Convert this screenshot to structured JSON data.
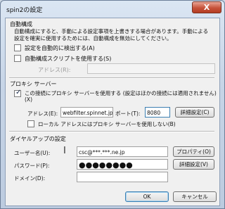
{
  "window": {
    "title": "spin2の設定",
    "close_glyph": "X"
  },
  "auto_config": {
    "heading": "自動構成",
    "note_line1": "自動構成にすると、手動による設定事項を上書きする場合があります。手動による",
    "note_line2": "設定を確実に使用するためには、自動構成を無効にしてください。",
    "auto_detect_label": "設定を自動的に検出する(A)",
    "auto_detect_checked": false,
    "use_script_label": "自動構成スクリプトを使用する(S)",
    "use_script_checked": false,
    "address_label": "アドレス(R):",
    "address_value": ""
  },
  "proxy": {
    "heading": "プロキシ サーバー",
    "use_proxy_label_line1": "この接続にプロキシ サーバーを使用する (設定はほかの接続には適用されません)",
    "use_proxy_label_line2": "(X)",
    "use_proxy_checked": true,
    "address_label": "アドレス(E):",
    "address_value": "webfilter.spinnet.jp",
    "port_label": "ポート(T):",
    "port_value": "8080",
    "advanced_label": "詳細設定(C)",
    "bypass_local_label": "ローカル アドレスにはプロキシ サーバーを使用しない(B)",
    "bypass_local_checked": false
  },
  "dialup": {
    "heading": "ダイヤルアップの設定",
    "username_label": "ユーザー名(U):",
    "username_value": "csc@***.***.ne.jp",
    "password_label": "パスワード(P):",
    "password_value": "●●●●●●●●",
    "domain_label": "ドメイン(D):",
    "domain_value": "",
    "properties_label": "プロパティ(O)",
    "advanced_label": "詳細設定(V)"
  },
  "footer": {
    "ok_label": "OK",
    "cancel_label": "キャンセル"
  }
}
